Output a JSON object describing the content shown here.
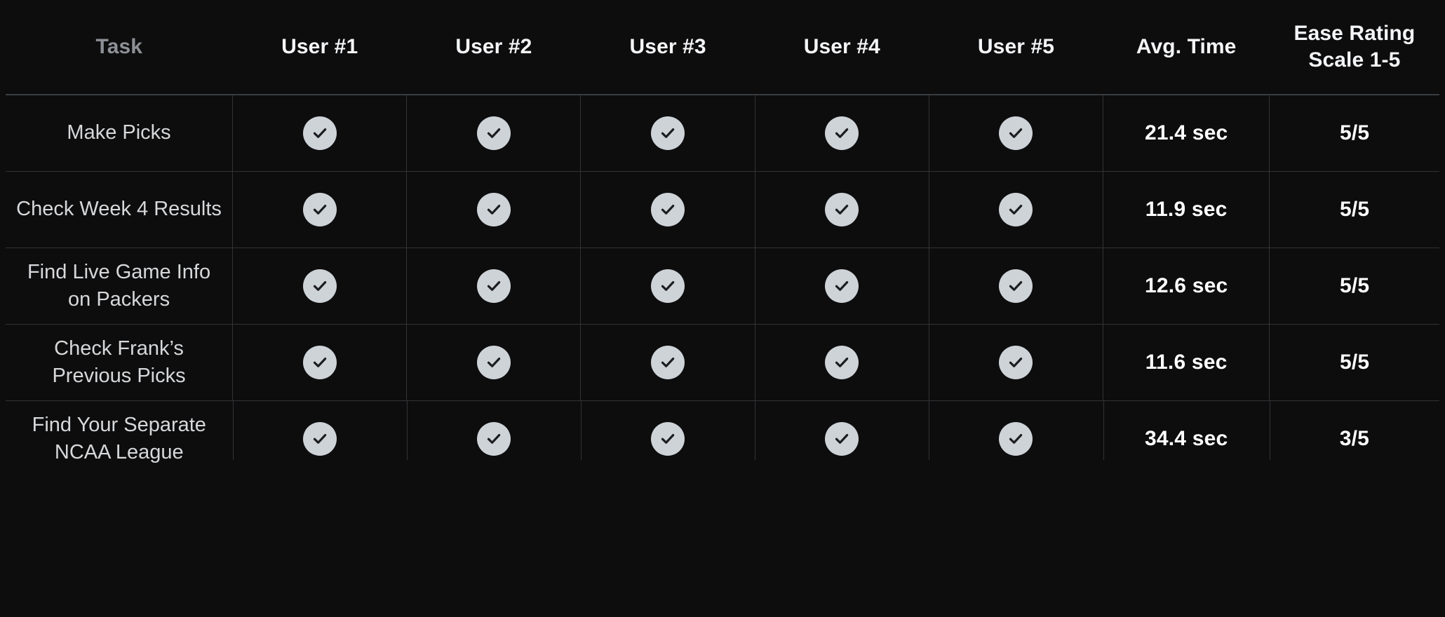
{
  "table": {
    "columns": [
      {
        "key": "task",
        "label": "Task"
      },
      {
        "key": "u1",
        "label": "User #1"
      },
      {
        "key": "u2",
        "label": "User #2"
      },
      {
        "key": "u3",
        "label": "User #3"
      },
      {
        "key": "u4",
        "label": "User #4"
      },
      {
        "key": "u5",
        "label": "User #5"
      },
      {
        "key": "time",
        "label": "Avg. Time"
      },
      {
        "key": "ease",
        "label_line1": "Ease Rating",
        "label_line2": "Scale 1-5"
      }
    ],
    "header": {
      "task": "Task",
      "user1": "User #1",
      "user2": "User #2",
      "user3": "User #3",
      "user4": "User #4",
      "user5": "User #5",
      "avg_time": "Avg. Time",
      "ease_line1": "Ease Rating",
      "ease_line2": "Scale 1-5"
    },
    "rows": [
      {
        "task_line1": "Make Picks",
        "task_line2": "",
        "user1": "check-icon",
        "user2": "check-icon",
        "user3": "check-icon",
        "user4": "check-icon",
        "user5": "check-icon",
        "avg_time": "21.4 sec",
        "ease": "5/5"
      },
      {
        "task_line1": "Check Week 4",
        "task_line2": "Results",
        "user1": "check-icon",
        "user2": "check-icon",
        "user3": "check-icon",
        "user4": "check-icon",
        "user5": "check-icon",
        "avg_time": "11.9 sec",
        "ease": "5/5"
      },
      {
        "task_line1": "Find Live Game",
        "task_line2": "Info on Packers",
        "user1": "check-icon",
        "user2": "check-icon",
        "user3": "check-icon",
        "user4": "check-icon",
        "user5": "check-icon",
        "avg_time": "12.6 sec",
        "ease": "5/5"
      },
      {
        "task_line1": "Check Frank’s",
        "task_line2": "Previous Picks",
        "user1": "check-icon",
        "user2": "check-icon",
        "user3": "check-icon",
        "user4": "check-icon",
        "user5": "check-icon",
        "avg_time": "11.6 sec",
        "ease": "5/5"
      },
      {
        "task_line1": "Find Your Separate",
        "task_line2": "NCAA League",
        "user1": "check-icon",
        "user2": "check-icon",
        "user3": "check-icon",
        "user4": "check-icon",
        "user5": "check-icon",
        "avg_time": "34.4 sec",
        "ease": "3/5"
      }
    ]
  },
  "colors": {
    "background": "#0d0d0e",
    "grid_line": "#313335",
    "header_rule": "#3a3c3e",
    "header_text": "#f4f5f7",
    "task_header_text": "#8d9095",
    "task_text": "#d6d8da",
    "value_text": "#ffffff",
    "check_circle": "#ced3d8",
    "check_mark": "#1b1d1f"
  }
}
